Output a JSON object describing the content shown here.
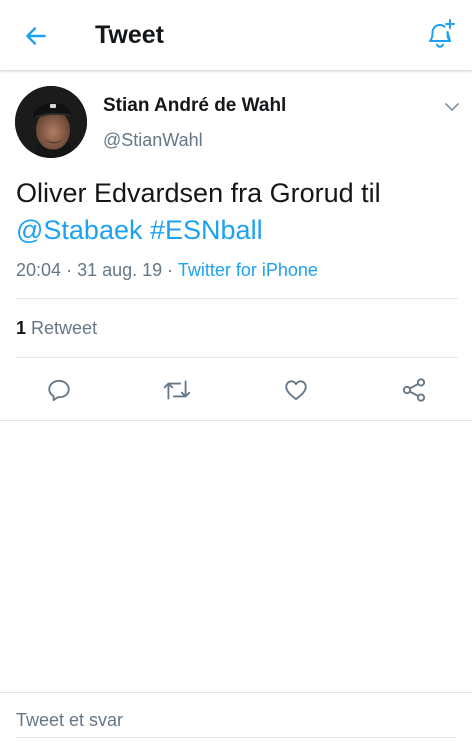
{
  "header": {
    "title": "Tweet",
    "back_icon": "arrow-left-icon",
    "notify_icon": "bell-plus-icon"
  },
  "tweet": {
    "display_name": "Stian André de Wahl",
    "handle": "@StianWahl",
    "text_plain": "Oliver Edvardsen fra Grorud til ",
    "mention": "@Stabaek",
    "hashtag": "#ESNball",
    "time": "20:04",
    "date": "31 aug. 19",
    "separator": "·",
    "source": "Twitter for iPhone",
    "retweet_count": "1",
    "retweet_label": "Retweet"
  },
  "actions": {
    "reply_icon": "reply-icon",
    "retweet_icon": "retweet-icon",
    "like_icon": "heart-icon",
    "share_icon": "share-icon"
  },
  "reply": {
    "placeholder": "Tweet et svar"
  },
  "colors": {
    "accent": "#1da1f2",
    "text": "#14171a",
    "secondary": "#657786",
    "divider": "#e1e8ed"
  }
}
